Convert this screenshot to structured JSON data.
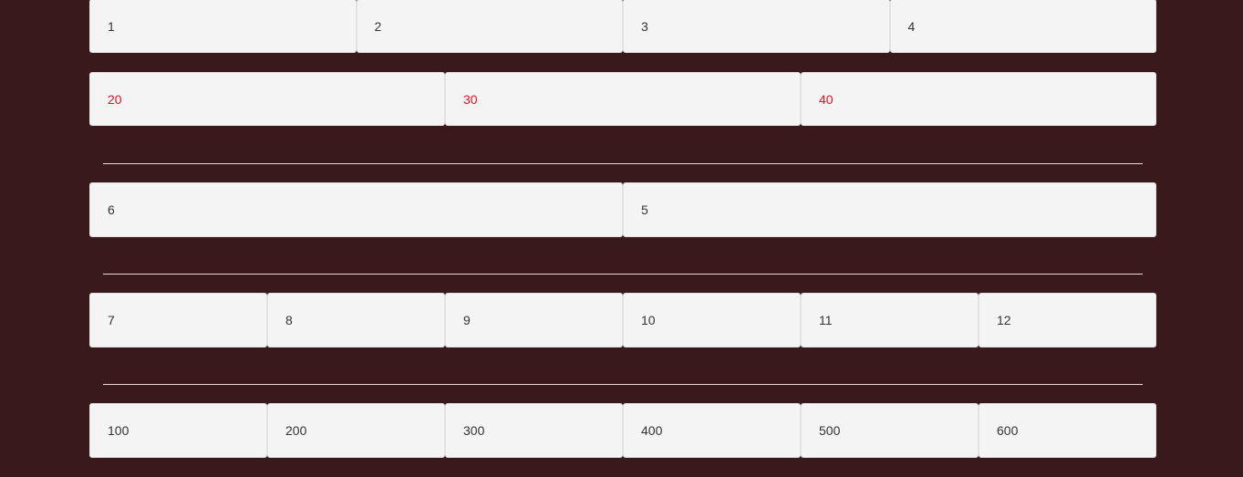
{
  "rows": [
    {
      "cells": [
        "1",
        "2",
        "3",
        "4"
      ]
    },
    {
      "cells": [
        "20",
        "30",
        "40"
      ],
      "text_color": "#e8101d"
    },
    {
      "cells": [
        "6",
        "5"
      ]
    },
    {
      "cells": [
        "7",
        "8",
        "9",
        "10",
        "11",
        "12"
      ]
    },
    {
      "cells": [
        "100",
        "200",
        "300",
        "400",
        "500",
        "600"
      ]
    }
  ],
  "colors": {
    "background": "#3a191c",
    "cell_background": "#f4f4f4",
    "cell_text": "#333333",
    "highlight_text": "#e8101d",
    "divider": "#e9dcdc"
  }
}
